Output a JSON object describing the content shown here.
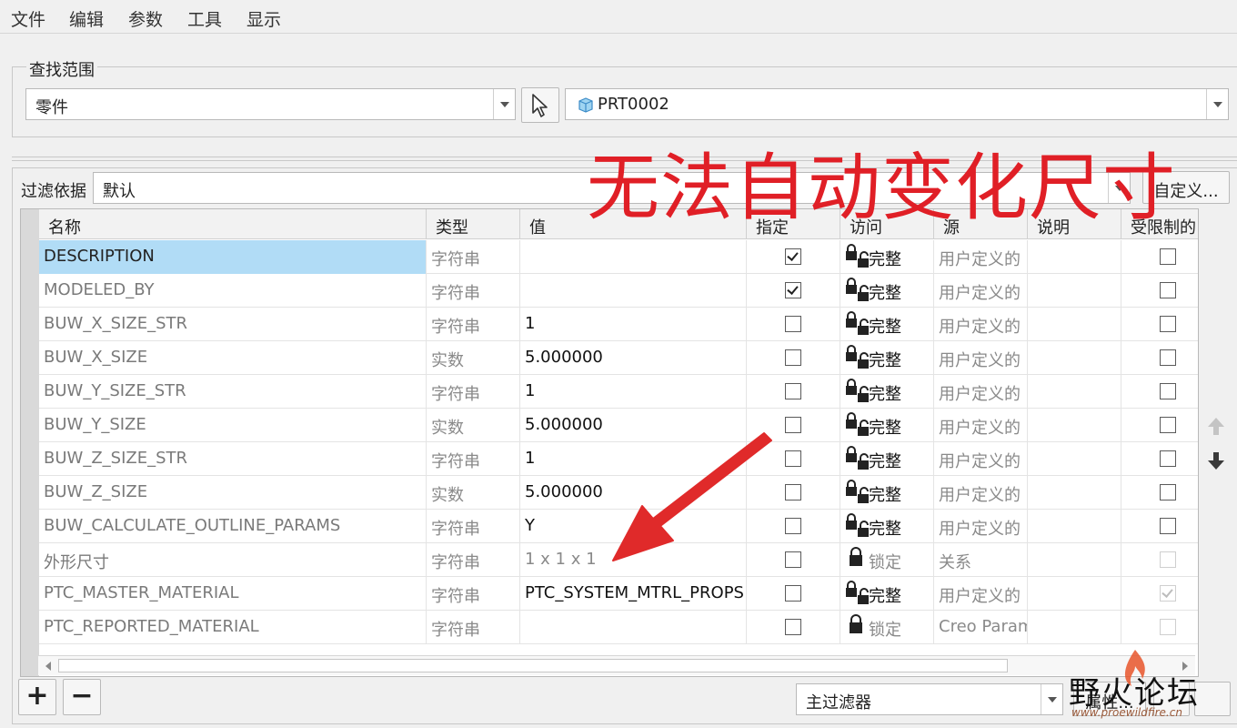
{
  "menu": [
    "文件",
    "编辑",
    "参数",
    "工具",
    "显示"
  ],
  "search_scope": {
    "title": "查找范围",
    "type_value": "零件",
    "model_value": "PRT0002"
  },
  "filter": {
    "label": "过滤依据",
    "value": "默认",
    "custom_button": "自定义..."
  },
  "annotation": "无法自动变化尺寸",
  "table": {
    "columns": [
      "名称",
      "类型",
      "值",
      "指定",
      "访问",
      "源",
      "说明",
      "受限制的"
    ],
    "rows": [
      {
        "name": "DESCRIPTION",
        "type": "字符串",
        "value": "",
        "designate": true,
        "access": "完整",
        "source": "用户定义的",
        "restricted": false,
        "restricted_disabled": false,
        "selected": true,
        "locked": false
      },
      {
        "name": "MODELED_BY",
        "type": "字符串",
        "value": "",
        "designate": true,
        "access": "完整",
        "source": "用户定义的",
        "restricted": false,
        "restricted_disabled": false,
        "selected": false,
        "locked": false
      },
      {
        "name": "BUW_X_SIZE_STR",
        "type": "字符串",
        "value": "1",
        "designate": false,
        "access": "完整",
        "source": "用户定义的",
        "restricted": false,
        "restricted_disabled": false,
        "selected": false,
        "locked": false
      },
      {
        "name": "BUW_X_SIZE",
        "type": "实数",
        "value": "5.000000",
        "designate": false,
        "access": "完整",
        "source": "用户定义的",
        "restricted": false,
        "restricted_disabled": false,
        "selected": false,
        "locked": false
      },
      {
        "name": "BUW_Y_SIZE_STR",
        "type": "字符串",
        "value": "1",
        "designate": false,
        "access": "完整",
        "source": "用户定义的",
        "restricted": false,
        "restricted_disabled": false,
        "selected": false,
        "locked": false
      },
      {
        "name": "BUW_Y_SIZE",
        "type": "实数",
        "value": "5.000000",
        "designate": false,
        "access": "完整",
        "source": "用户定义的",
        "restricted": false,
        "restricted_disabled": false,
        "selected": false,
        "locked": false
      },
      {
        "name": "BUW_Z_SIZE_STR",
        "type": "字符串",
        "value": "1",
        "designate": false,
        "access": "完整",
        "source": "用户定义的",
        "restricted": false,
        "restricted_disabled": false,
        "selected": false,
        "locked": false
      },
      {
        "name": "BUW_Z_SIZE",
        "type": "实数",
        "value": "5.000000",
        "designate": false,
        "access": "完整",
        "source": "用户定义的",
        "restricted": false,
        "restricted_disabled": false,
        "selected": false,
        "locked": false
      },
      {
        "name": "BUW_CALCULATE_OUTLINE_PARAMS",
        "type": "字符串",
        "value": "Y",
        "designate": false,
        "access": "完整",
        "source": "用户定义的",
        "restricted": false,
        "restricted_disabled": false,
        "selected": false,
        "locked": false
      },
      {
        "name": "外形尺寸",
        "type": "字符串",
        "value": "1 x 1 x 1",
        "designate": false,
        "access": "锁定",
        "source": "关系",
        "restricted": false,
        "restricted_disabled": true,
        "selected": false,
        "locked": true
      },
      {
        "name": "PTC_MASTER_MATERIAL",
        "type": "字符串",
        "value": "PTC_SYSTEM_MTRL_PROPS",
        "designate": false,
        "access": "完整",
        "source": "用户定义的",
        "restricted": true,
        "restricted_disabled": true,
        "selected": false,
        "locked": false
      },
      {
        "name": "PTC_REPORTED_MATERIAL",
        "type": "字符串",
        "value": "",
        "designate": false,
        "access": "锁定",
        "source": "Creo Param",
        "restricted": false,
        "restricted_disabled": true,
        "selected": false,
        "locked": true
      }
    ]
  },
  "bottom": {
    "add_label": "+",
    "remove_label": "−",
    "main_filter_value": "主过滤器",
    "properties_button": "属性..."
  },
  "watermark": {
    "title": "野火论坛",
    "url": "www.proewildfire.cn"
  },
  "colors": {
    "annotation": "#e01f26",
    "selection": "#b1dcf6",
    "arrow": "#e02a2a"
  }
}
